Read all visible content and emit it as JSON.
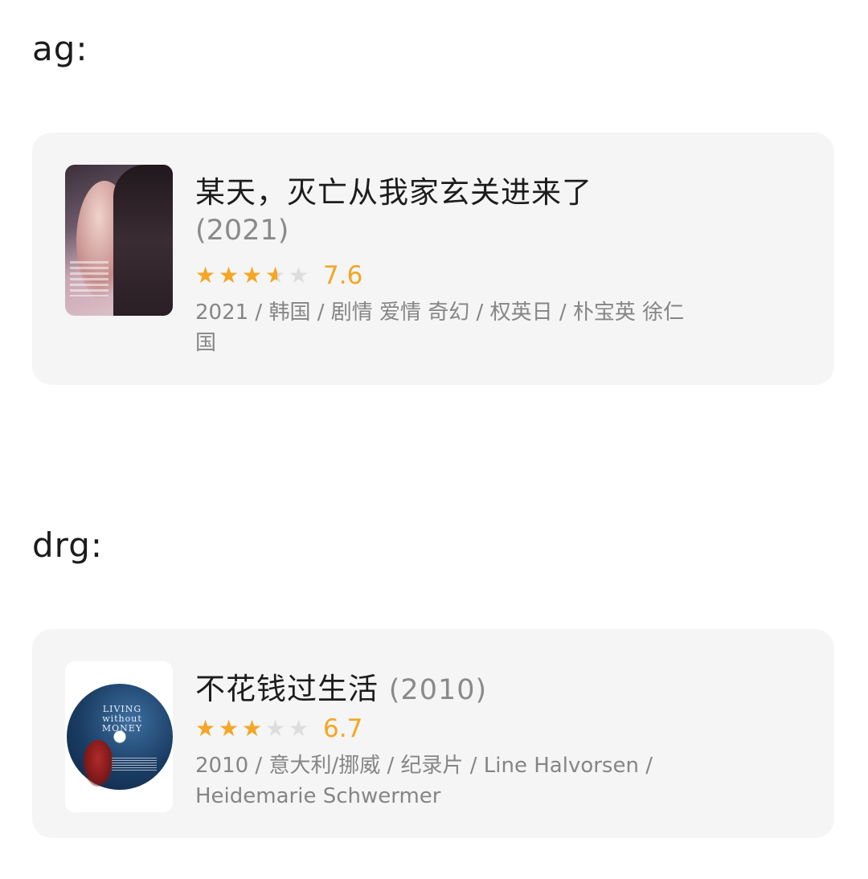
{
  "sections": [
    {
      "label": "ag:",
      "movie": {
        "title": "某天，灭亡从我家玄关进来了",
        "year": "(2021)",
        "rating_stars": 3.5,
        "score": "7.6",
        "meta": "2021 / 韩国 / 剧情 爱情 奇幻 / 权英日 / 朴宝英 徐仁国",
        "poster_icon": "poster-image"
      }
    },
    {
      "label": "drg:",
      "movie": {
        "title": "不花钱过生活",
        "year": "(2010)",
        "rating_stars": 3,
        "score": "6.7",
        "meta": "2010 / 意大利/挪威 / 纪录片 / Line Halvorsen / Heidemarie Schwermer",
        "poster_text": "LIVING without MONEY",
        "poster_icon": "poster-image"
      }
    }
  ],
  "colors": {
    "star_filled": "#f5a623",
    "star_empty": "#dddddd",
    "card_bg": "#f5f5f5"
  }
}
